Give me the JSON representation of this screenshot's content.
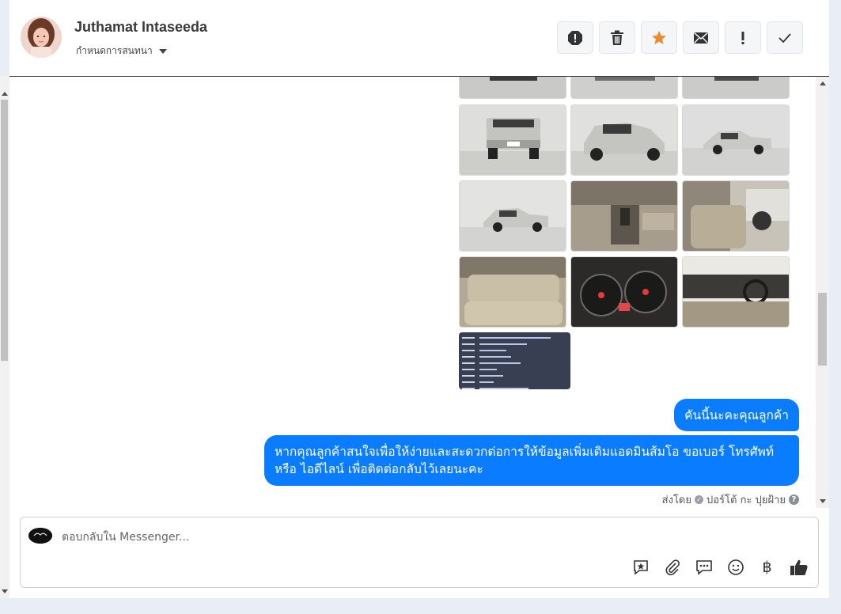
{
  "header": {
    "name": "Juthamat Intaseeda",
    "assign_label": "กำหนดการสนทนา",
    "actions": [
      {
        "name": "report-icon"
      },
      {
        "name": "trash-icon"
      },
      {
        "name": "star-icon",
        "color": "#f0892a"
      },
      {
        "name": "mail-icon"
      },
      {
        "name": "exclamation-icon"
      },
      {
        "name": "check-icon"
      }
    ]
  },
  "conversation": {
    "photo_count": 13,
    "message_short": "คันนี้นะคะคุณลูกค้า",
    "message_long": "หากคุณลูกค้าสนใจเพื่อให้ง่ายและสะดวกต่อการให้ข้อมูลเพิ่มเติมแอดมินส้มโอ ขอเบอร์ โทรศัพท์ หรือ ไอดีไลน์ เพื่อติดต่อกลับไว้เลยนะคะ",
    "sent_by_label": "ส่งโดย",
    "sent_by_name": "ปอร์โต้ กะ ปุยฝ้าย",
    "help_glyph": "?",
    "bubble_color": "#0a7cff"
  },
  "composer": {
    "placeholder": "ตอบกลับใน Messenger...",
    "tools": [
      "quick-reply-icon",
      "attachment-icon",
      "chat-bubble-icon",
      "emoji-icon",
      "baht-icon",
      "thumbs-up-icon"
    ],
    "baht_glyph": "฿"
  }
}
